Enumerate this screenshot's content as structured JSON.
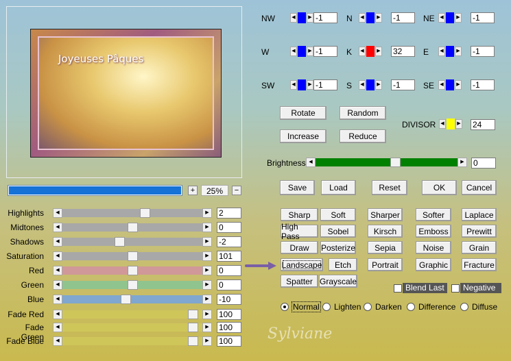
{
  "preview": {
    "title": "Joyeuses Pâques",
    "zoom_label": "25%",
    "plus": "+",
    "minus": "−",
    "progress_percent": 100
  },
  "directions": [
    {
      "key": "nw",
      "label": "NW",
      "value": "-1",
      "color": "#0000ff"
    },
    {
      "key": "n",
      "label": "N",
      "value": "-1",
      "color": "#0000ff"
    },
    {
      "key": "ne",
      "label": "NE",
      "value": "-1",
      "color": "#0000ff"
    },
    {
      "key": "w",
      "label": "W",
      "value": "-1",
      "color": "#0000ff"
    },
    {
      "key": "k",
      "label": "K",
      "value": "32",
      "color": "#ff0000"
    },
    {
      "key": "e",
      "label": "E",
      "value": "-1",
      "color": "#0000ff"
    },
    {
      "key": "sw",
      "label": "SW",
      "value": "-1",
      "color": "#0000ff"
    },
    {
      "key": "s",
      "label": "S",
      "value": "-1",
      "color": "#0000ff"
    },
    {
      "key": "se",
      "label": "SE",
      "value": "-1",
      "color": "#0000ff"
    }
  ],
  "matrix_buttons": {
    "rotate": "Rotate",
    "random": "Random",
    "increase": "Increase",
    "reduce": "Reduce"
  },
  "divisor": {
    "label": "DIVISOR",
    "value": "24",
    "color": "#ffff00"
  },
  "brightness": {
    "label": "Brightness",
    "value": "0",
    "fill_fraction": 0.86,
    "color": "#008000"
  },
  "actions": {
    "save": "Save",
    "load": "Load",
    "reset": "Reset",
    "ok": "OK",
    "cancel": "Cancel"
  },
  "adjust_sliders": [
    {
      "label": "Highlights",
      "value": "2",
      "level": 0.6,
      "color": "#a8a8a8"
    },
    {
      "label": "Midtones",
      "value": "0",
      "level": 0.5,
      "color": "#a8a8a8"
    },
    {
      "label": "Shadows",
      "value": "-2",
      "level": 0.4,
      "color": "#a8a8a8"
    },
    {
      "label": "Saturation",
      "value": "101",
      "level": 0.5,
      "color": "#a8a8a8"
    },
    {
      "label": "Red",
      "value": "0",
      "level": 0.5,
      "color": "#d09898"
    },
    {
      "label": "Green",
      "value": "0",
      "level": 0.5,
      "color": "#8fc48f"
    },
    {
      "label": "Blue",
      "value": "-10",
      "level": 0.45,
      "color": "#7fa7cf"
    }
  ],
  "fade_sliders": [
    {
      "label": "Fade Red",
      "value": "100",
      "level": 0.97,
      "color": "#cfc65a"
    },
    {
      "label": "Fade Green",
      "value": "100",
      "level": 0.97,
      "color": "#cfc65a"
    },
    {
      "label": "Fade Blue",
      "value": "100",
      "level": 0.97,
      "color": "#cfc65a"
    }
  ],
  "presets": [
    [
      "Sharp",
      "Soft",
      "Sharper",
      "Softer",
      "Laplace"
    ],
    [
      "High Pass",
      "Sobel",
      "Kirsch",
      "Emboss",
      "Prewitt"
    ],
    [
      "Draw",
      "Posterize",
      "Sepia",
      "Noise",
      "Grain"
    ],
    [
      "Landscape",
      "Etch",
      "Portrait",
      "Graphic",
      "Fracture"
    ],
    [
      "Spatter",
      "Grayscale"
    ]
  ],
  "selected_preset": "Landscape",
  "checkboxes": {
    "blend_last": "Blend Last",
    "negative": "Negative"
  },
  "blend_modes": [
    "Normal",
    "Lighten",
    "Darken",
    "Difference",
    "Diffuse"
  ],
  "selected_blend": "Normal",
  "watermark": "Sylviane"
}
